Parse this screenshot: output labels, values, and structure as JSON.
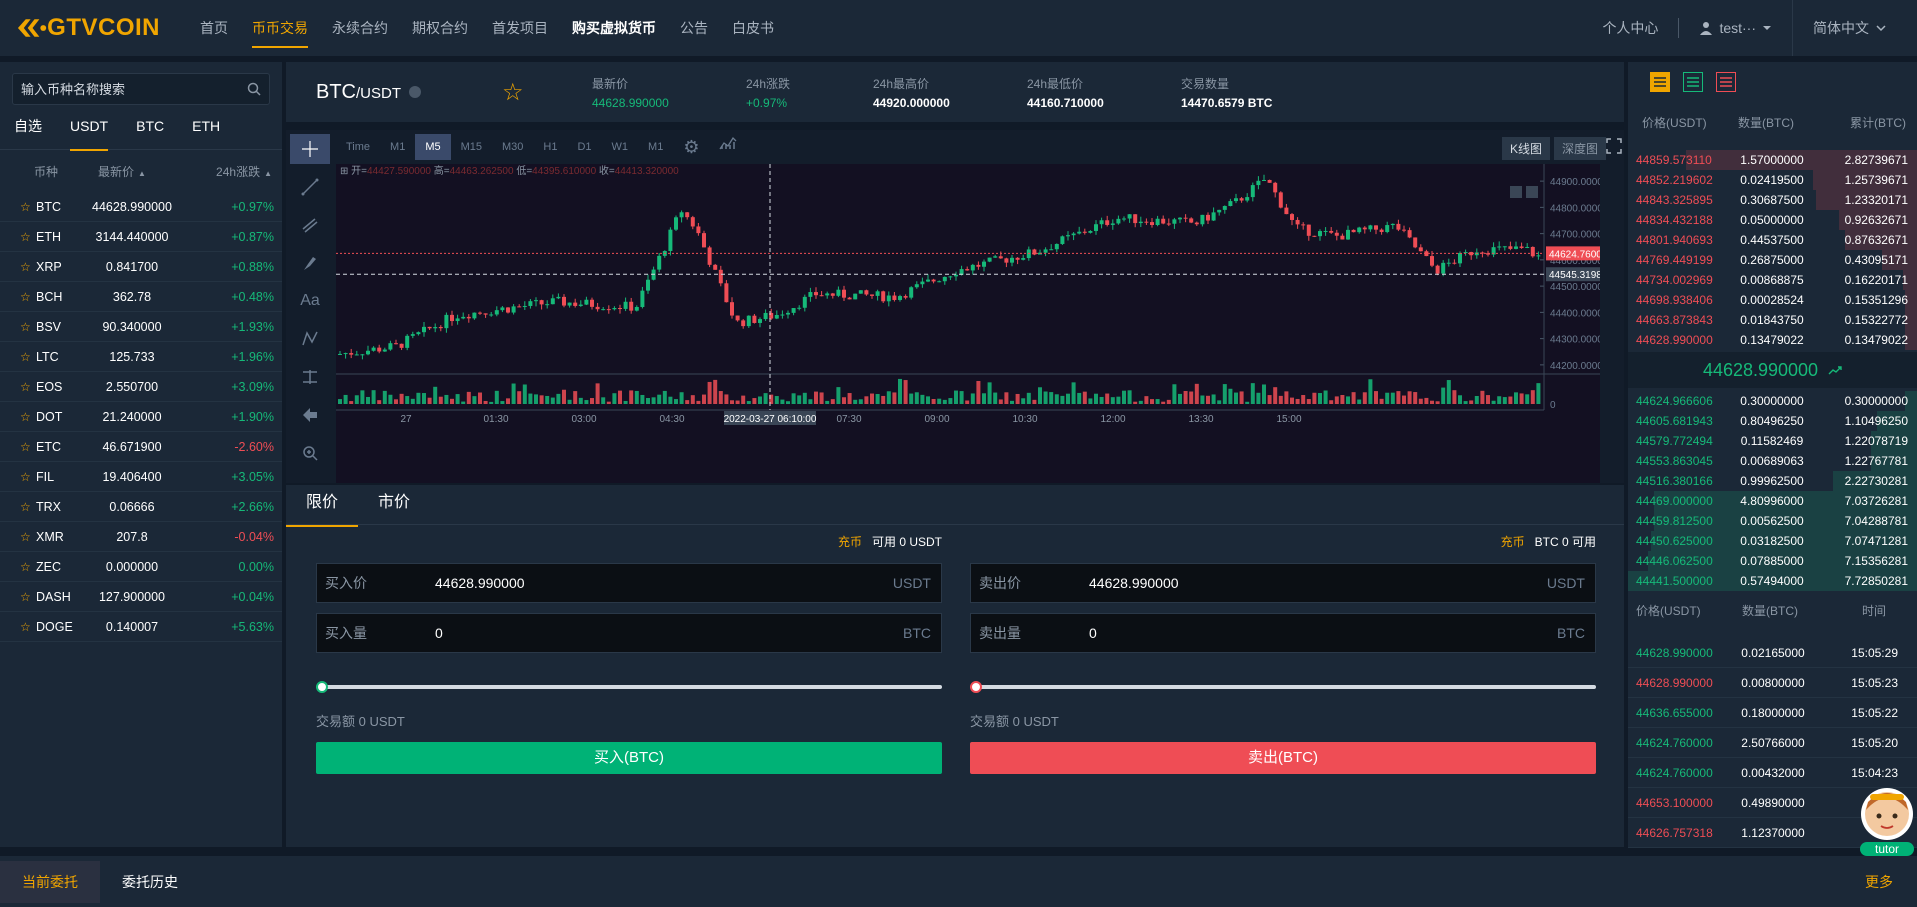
{
  "brand": {
    "logo_text": "GTVCOIN"
  },
  "nav": {
    "items": [
      {
        "label": "首页",
        "state": "normal"
      },
      {
        "label": "币币交易",
        "state": "active"
      },
      {
        "label": "永续合约",
        "state": "normal"
      },
      {
        "label": "期权合约",
        "state": "normal"
      },
      {
        "label": "首发项目",
        "state": "normal"
      },
      {
        "label": "购买虚拟货币",
        "state": "bold"
      },
      {
        "label": "公告",
        "state": "normal"
      },
      {
        "label": "白皮书",
        "state": "normal"
      }
    ],
    "personal_center": "个人中心",
    "username": "test···",
    "language": "简体中文"
  },
  "market_list": {
    "search_placeholder": "输入币种名称搜索",
    "tabs": [
      "自选",
      "USDT",
      "BTC",
      "ETH"
    ],
    "active_tab": "USDT",
    "header": {
      "coin": "币种",
      "price": "最新价",
      "change": "24h涨跌"
    },
    "rows": [
      {
        "symbol": "BTC",
        "price": "44628.990000",
        "change": "+0.97%",
        "dir": "up"
      },
      {
        "symbol": "ETH",
        "price": "3144.440000",
        "change": "+0.87%",
        "dir": "up"
      },
      {
        "symbol": "XRP",
        "price": "0.841700",
        "change": "+0.88%",
        "dir": "up"
      },
      {
        "symbol": "BCH",
        "price": "362.78",
        "change": "+0.48%",
        "dir": "up"
      },
      {
        "symbol": "BSV",
        "price": "90.340000",
        "change": "+1.93%",
        "dir": "up"
      },
      {
        "symbol": "LTC",
        "price": "125.733",
        "change": "+1.96%",
        "dir": "up"
      },
      {
        "symbol": "EOS",
        "price": "2.550700",
        "change": "+3.09%",
        "dir": "up"
      },
      {
        "symbol": "DOT",
        "price": "21.240000",
        "change": "+1.90%",
        "dir": "up"
      },
      {
        "symbol": "ETC",
        "price": "46.671900",
        "change": "-2.60%",
        "dir": "down"
      },
      {
        "symbol": "FIL",
        "price": "19.406400",
        "change": "+3.05%",
        "dir": "up"
      },
      {
        "symbol": "TRX",
        "price": "0.06666",
        "change": "+2.66%",
        "dir": "up"
      },
      {
        "symbol": "XMR",
        "price": "207.8",
        "change": "-0.04%",
        "dir": "down"
      },
      {
        "symbol": "ZEC",
        "price": "0.000000",
        "change": "0.00%",
        "dir": "up"
      },
      {
        "symbol": "DASH",
        "price": "127.900000",
        "change": "+0.04%",
        "dir": "up"
      },
      {
        "symbol": "DOGE",
        "price": "0.140007",
        "change": "+5.63%",
        "dir": "up"
      }
    ]
  },
  "ticker": {
    "pair_base": "BTC",
    "pair_quote": "/USDT",
    "stats": [
      {
        "label": "最新价",
        "value": "44628.990000",
        "color": "up"
      },
      {
        "label": "24h涨跌",
        "value": "+0.97%",
        "color": "up"
      },
      {
        "label": "24h最高价",
        "value": "44920.000000",
        "color": "white"
      },
      {
        "label": "24h最低价",
        "value": "44160.710000",
        "color": "white"
      },
      {
        "label": "交易数量",
        "value": "14470.6579 BTC",
        "color": "white"
      }
    ]
  },
  "chart": {
    "timeframes": [
      "Time",
      "M1",
      "M5",
      "M15",
      "M30",
      "H1",
      "D1",
      "W1",
      "M1"
    ],
    "active_timeframe": "M5",
    "view_buttons": [
      "K线图",
      "深度图"
    ],
    "active_view": "K线图",
    "ohlc_legend": {
      "open_label": "开=",
      "open": "44427.590000",
      "high_label": "高=",
      "high": "44463.262500",
      "low_label": "低=",
      "low": "44395.610000",
      "close_label": "收=",
      "close": "44413.320000"
    },
    "price_ticks": [
      "44900.000000",
      "44800.000000",
      "44700.000000",
      "44600.000000",
      "44500.000000",
      "44400.000000",
      "44300.000000",
      "44200.000000"
    ],
    "volume_tick": "0",
    "time_ticks": [
      "27",
      "01:30",
      "03:00",
      "04:30",
      "06:00",
      "07:30",
      "09:00",
      "10:30",
      "12:00",
      "13:30",
      "15:00"
    ],
    "last_price_tag": "44624.760000",
    "crosshair_price_tag": "44545.319843",
    "crosshair_time_tag": "2022-03-27 06:10:00"
  },
  "order_form": {
    "tabs": [
      "限价",
      "市价"
    ],
    "active_tab": "限价",
    "buy": {
      "recharge": "充币",
      "available": "可用  0  USDT",
      "price_label": "买入价",
      "price_value": "44628.990000",
      "price_unit": "USDT",
      "qty_label": "买入量",
      "qty_value": "0",
      "qty_unit": "BTC",
      "amount": "交易额 0 USDT",
      "button": "买入(BTC)",
      "slider_percent": 0
    },
    "sell": {
      "recharge": "充币",
      "available": "BTC  0  可用",
      "price_label": "卖出价",
      "price_value": "44628.990000",
      "price_unit": "USDT",
      "qty_label": "卖出量",
      "qty_value": "0",
      "qty_unit": "BTC",
      "amount": "交易额 0 USDT",
      "button": "卖出(BTC)",
      "slider_percent": 0
    }
  },
  "order_book": {
    "header": {
      "price": "价格(USDT)",
      "qty": "数量(BTC)",
      "total": "累计(BTC)"
    },
    "asks": [
      {
        "price": "44859.573110",
        "qty": "1.57000000",
        "total": "2.82739671",
        "depth": 0.8
      },
      {
        "price": "44852.219602",
        "qty": "0.02419500",
        "total": "1.25739671",
        "depth": 0.36
      },
      {
        "price": "44843.325895",
        "qty": "0.30687500",
        "total": "1.23320171",
        "depth": 0.35
      },
      {
        "price": "44834.432188",
        "qty": "0.05000000",
        "total": "0.92632671",
        "depth": 0.27
      },
      {
        "price": "44801.940693",
        "qty": "0.44537500",
        "total": "0.87632671",
        "depth": 0.25
      },
      {
        "price": "44769.449199",
        "qty": "0.26875000",
        "total": "0.43095171",
        "depth": 0.12
      },
      {
        "price": "44734.002969",
        "qty": "0.00868875",
        "total": "0.16220171",
        "depth": 0.05
      },
      {
        "price": "44698.938406",
        "qty": "0.00028524",
        "total": "0.15351296",
        "depth": 0.04
      },
      {
        "price": "44663.873843",
        "qty": "0.01843750",
        "total": "0.15322772",
        "depth": 0.04
      },
      {
        "price": "44628.990000",
        "qty": "0.13479022",
        "total": "0.13479022",
        "depth": 0.04
      }
    ],
    "mid_price": "44628.990000",
    "bids": [
      {
        "price": "44624.966606",
        "qty": "0.30000000",
        "total": "0.30000000",
        "depth": 0.04
      },
      {
        "price": "44605.681943",
        "qty": "0.80496250",
        "total": "1.10496250",
        "depth": 0.14
      },
      {
        "price": "44579.772494",
        "qty": "0.11582469",
        "total": "1.22078719",
        "depth": 0.16
      },
      {
        "price": "44553.863045",
        "qty": "0.00689063",
        "total": "1.22767781",
        "depth": 0.16
      },
      {
        "price": "44516.380166",
        "qty": "0.99962500",
        "total": "2.22730281",
        "depth": 0.29
      },
      {
        "price": "44469.000000",
        "qty": "4.80996000",
        "total": "7.03726281",
        "depth": 0.91
      },
      {
        "price": "44459.812500",
        "qty": "0.00562500",
        "total": "7.04288781",
        "depth": 0.91
      },
      {
        "price": "44450.625000",
        "qty": "0.03182500",
        "total": "7.07471281",
        "depth": 0.92
      },
      {
        "price": "44446.062500",
        "qty": "0.07885000",
        "total": "7.15356281",
        "depth": 0.93
      },
      {
        "price": "44441.500000",
        "qty": "0.57494000",
        "total": "7.72850281",
        "depth": 1.0
      }
    ]
  },
  "trades": {
    "header": {
      "price": "价格(USDT)",
      "qty": "数量(BTC)",
      "time": "时间"
    },
    "rows": [
      {
        "price": "44628.990000",
        "qty": "0.02165000",
        "time": "15:05:29",
        "dir": "up"
      },
      {
        "price": "44628.990000",
        "qty": "0.00800000",
        "time": "15:05:23",
        "dir": "down"
      },
      {
        "price": "44636.655000",
        "qty": "0.18000000",
        "time": "15:05:22",
        "dir": "up"
      },
      {
        "price": "44624.760000",
        "qty": "2.50766000",
        "time": "15:05:20",
        "dir": "up"
      },
      {
        "price": "44624.760000",
        "qty": "0.00432000",
        "time": "15:04:23",
        "dir": "up"
      },
      {
        "price": "44653.100000",
        "qty": "0.49890000",
        "time": "15:",
        "dir": "down"
      },
      {
        "price": "44626.757318",
        "qty": "1.12370000",
        "time": "15:",
        "dir": "down"
      }
    ]
  },
  "bottom": {
    "tabs": [
      "当前委托",
      "委托历史"
    ],
    "active_tab": "当前委托",
    "more": "更多"
  },
  "tutor": {
    "label": "tutor"
  },
  "colors": {
    "accent": "#f0a500",
    "up": "#16b979",
    "down": "#ef4d55",
    "panel": "#1b2837",
    "bg": "#101a27"
  }
}
